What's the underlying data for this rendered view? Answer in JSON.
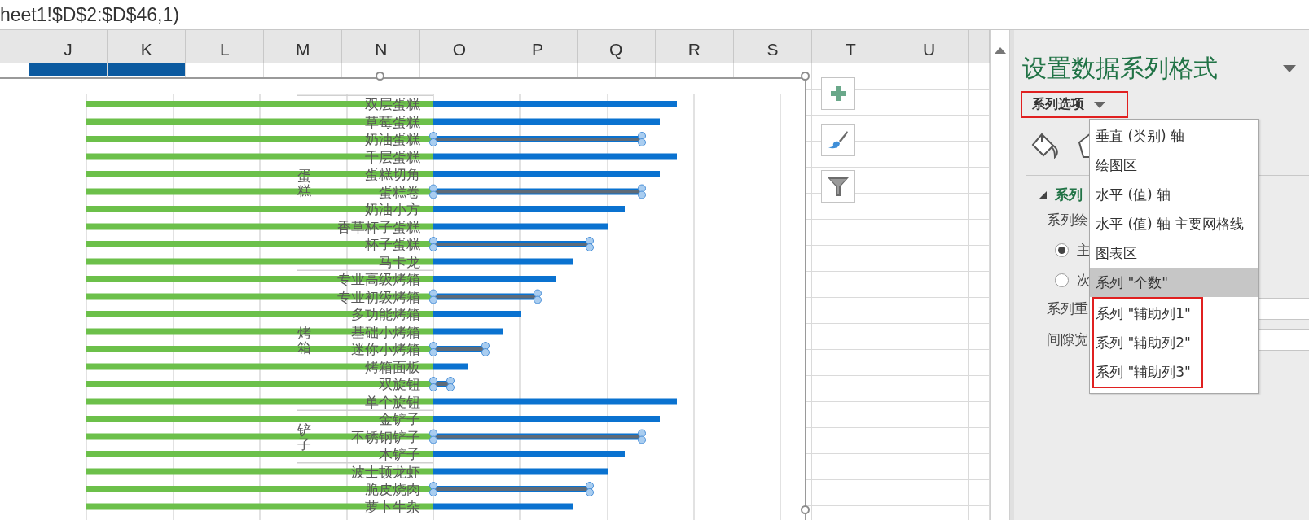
{
  "formula_bar": {
    "text": "heet1!$D$2:$D$46,1)"
  },
  "columns": [
    {
      "label": "J",
      "in_range": true
    },
    {
      "label": "K",
      "in_range": true
    },
    {
      "label": "L",
      "in_range": false
    },
    {
      "label": "M",
      "in_range": false
    },
    {
      "label": "N",
      "in_range": false
    },
    {
      "label": "O",
      "in_range": false
    },
    {
      "label": "P",
      "in_range": false
    },
    {
      "label": "Q",
      "in_range": false
    },
    {
      "label": "R",
      "in_range": false
    },
    {
      "label": "S",
      "in_range": false
    },
    {
      "label": "T",
      "in_range": false
    },
    {
      "label": "U",
      "in_range": false
    }
  ],
  "chart": {
    "groups": [
      {
        "label": "蛋糕",
        "items": [
          {
            "label": "双层蛋糕",
            "selected": false
          },
          {
            "label": "草莓蛋糕",
            "selected": false
          },
          {
            "label": "奶油蛋糕",
            "selected": true
          },
          {
            "label": "千层蛋糕",
            "selected": false
          },
          {
            "label": "蛋糕切角",
            "selected": false
          },
          {
            "label": "蛋糕卷",
            "selected": true
          },
          {
            "label": "奶油小方",
            "selected": false
          },
          {
            "label": "香草杯子蛋糕",
            "selected": false
          },
          {
            "label": "杯子蛋糕",
            "selected": true
          },
          {
            "label": "马卡龙",
            "selected": false
          }
        ]
      },
      {
        "label": "烤箱",
        "items": [
          {
            "label": "专业高级烤箱",
            "selected": false
          },
          {
            "label": "专业初级烤箱",
            "selected": true
          },
          {
            "label": "多功能烤箱",
            "selected": false
          },
          {
            "label": "基础小烤箱",
            "selected": false
          },
          {
            "label": "迷你小烤箱",
            "selected": true
          },
          {
            "label": "烤箱面板",
            "selected": false
          },
          {
            "label": "双旋钮",
            "selected": true
          },
          {
            "label": "单个旋钮",
            "selected": false
          }
        ]
      },
      {
        "label": "铲子",
        "items": [
          {
            "label": "金铲子",
            "selected": false
          },
          {
            "label": "不锈钢铲子",
            "selected": true
          },
          {
            "label": "木铲子",
            "selected": false
          }
        ]
      },
      {
        "items": [
          {
            "label": "波士顿龙虾",
            "selected": false
          },
          {
            "label": "脆皮烧肉",
            "selected": true
          },
          {
            "label": "萝卜牛杂",
            "selected": false
          }
        ]
      }
    ]
  },
  "panel": {
    "title": "设置数据系列格式",
    "options_button": {
      "label": "系列选项",
      "annotated": true
    },
    "section": {
      "label": "系列",
      "expanded": true
    },
    "plot_label": "系列绘",
    "radios": [
      {
        "label": "主",
        "selected": true
      },
      {
        "label": "次",
        "selected": false
      }
    ],
    "fields": [
      {
        "label": "系列重"
      },
      {
        "label": "间隙宽"
      }
    ],
    "menu": [
      {
        "label": "垂直 (类别) 轴",
        "selected": false,
        "annotated": false
      },
      {
        "label": "绘图区",
        "selected": false,
        "annotated": false
      },
      {
        "label": "水平 (值) 轴",
        "selected": false,
        "annotated": false
      },
      {
        "label": "水平 (值) 轴 主要网格线",
        "selected": false,
        "annotated": false
      },
      {
        "label": "图表区",
        "selected": false,
        "annotated": false
      },
      {
        "label": "系列 \"个数\"",
        "selected": true,
        "annotated": false
      },
      {
        "label": "系列 \"辅助列1\"",
        "selected": false,
        "annotated": true
      },
      {
        "label": "系列 \"辅助列2\"",
        "selected": false,
        "annotated": true
      },
      {
        "label": "系列 \"辅助列3\"",
        "selected": false,
        "annotated": true
      }
    ]
  }
}
